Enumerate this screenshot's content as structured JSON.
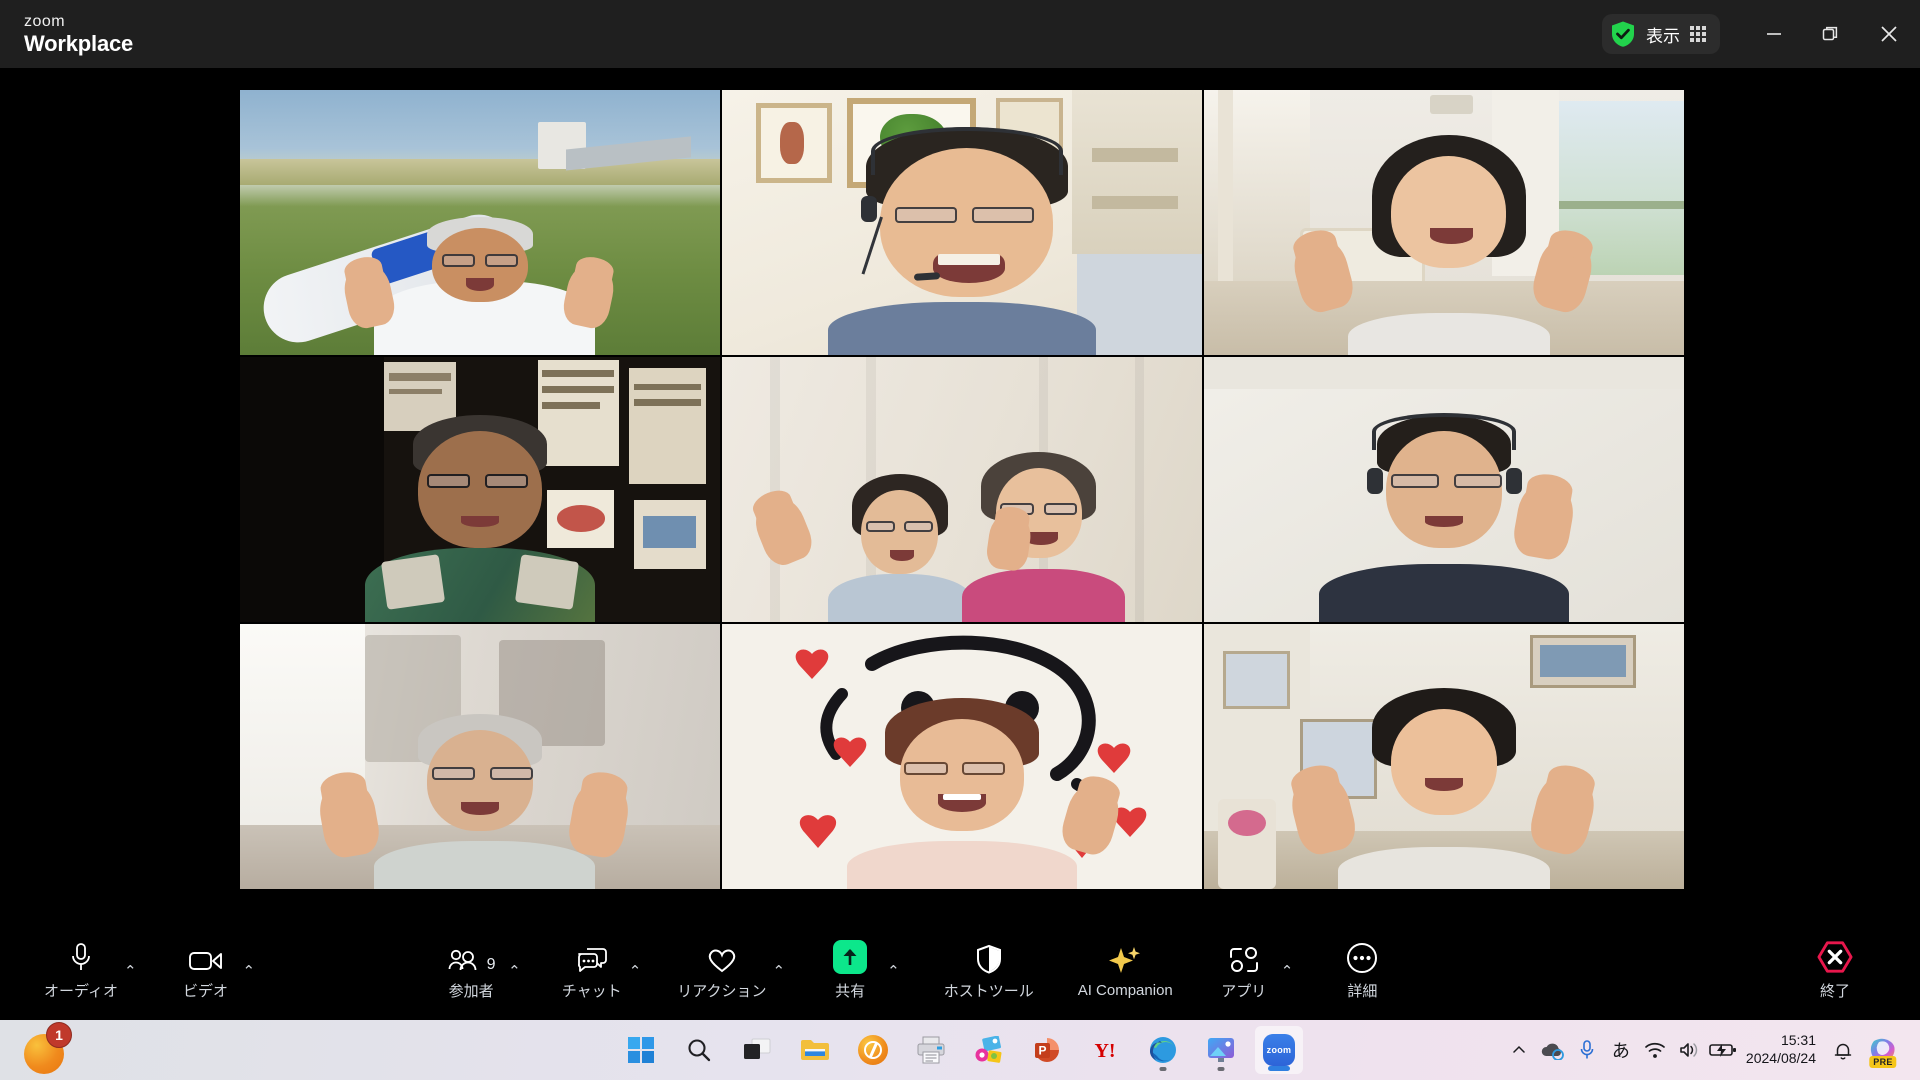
{
  "window": {
    "brand_zoom": "zoom",
    "brand_workplace": "Workplace",
    "view_label": "表示",
    "minimize_label": "最小化",
    "maximize_label": "最大化",
    "close_label": "閉じる"
  },
  "meeting": {
    "active_speaker_index": 1,
    "active_border_color": "#00e676",
    "tiles": [
      {
        "name": "participant-1",
        "scene": "outdoor-field"
      },
      {
        "name": "participant-2-active-speaker",
        "scene": "home-office-headset"
      },
      {
        "name": "participant-3",
        "scene": "bright-living-room"
      },
      {
        "name": "participant-4",
        "scene": "dark-study-posters"
      },
      {
        "name": "participant-5",
        "scene": "white-curtain-two-people"
      },
      {
        "name": "participant-6",
        "scene": "plain-wall-headset"
      },
      {
        "name": "participant-7",
        "scene": "blurred-indoor"
      },
      {
        "name": "participant-8",
        "scene": "drawing-backdrop"
      },
      {
        "name": "participant-9",
        "scene": "living-room-art"
      }
    ]
  },
  "toolbar": {
    "audio_label": "オーディオ",
    "video_label": "ビデオ",
    "participants_label": "参加者",
    "participants_count": "9",
    "chat_label": "チャット",
    "reactions_label": "リアクション",
    "share_label": "共有",
    "host_tools_label": "ホストツール",
    "ai_companion_label": "AI Companion",
    "apps_label": "アプリ",
    "more_label": "詳細",
    "end_label": "終了",
    "share_accent": "#0ce78b",
    "end_accent": "#e8174c",
    "ai_accent": "#f2c94c"
  },
  "taskbar": {
    "left_app_badge": "1",
    "time": "15:31",
    "date": "2024/08/24",
    "ime_label": "あ",
    "copilot_badge": "PRE",
    "items": [
      {
        "name": "start-button"
      },
      {
        "name": "search-button"
      },
      {
        "name": "task-view-button"
      },
      {
        "name": "file-explorer-button"
      },
      {
        "name": "orange-app-button"
      },
      {
        "name": "printer-app-button"
      },
      {
        "name": "photo-app-button"
      },
      {
        "name": "powerpoint-button"
      },
      {
        "name": "yahoo-button"
      },
      {
        "name": "edge-button"
      },
      {
        "name": "photos-button"
      },
      {
        "name": "zoom-button"
      }
    ]
  }
}
